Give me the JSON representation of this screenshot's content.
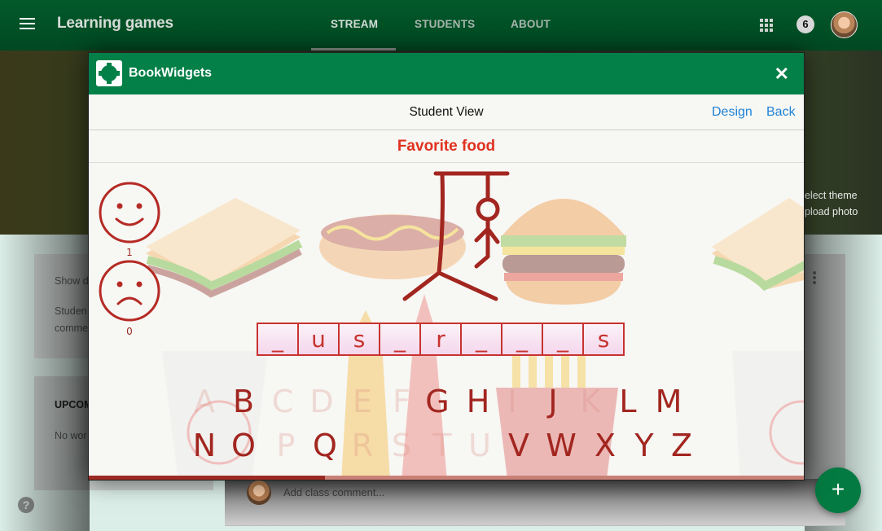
{
  "topbar": {
    "title": "Learning games",
    "tabs": [
      {
        "label": "STREAM",
        "active": true
      },
      {
        "label": "STUDENTS",
        "active": false
      },
      {
        "label": "ABOUT",
        "active": false
      }
    ],
    "notification_count": "6",
    "icons": {
      "menu": "hamburger-icon",
      "apps": "apps-grid-icon",
      "avatar": "user-avatar"
    }
  },
  "banner": {
    "select_theme": "elect theme",
    "upload_photo": "pload photo"
  },
  "background": {
    "left_card": {
      "line1": "Show d",
      "line2": "Studen",
      "line3": "comme"
    },
    "upcoming": {
      "heading": "UPCOM",
      "text": "No wor"
    },
    "comment_placeholder": "Add class comment...",
    "fab_label": "+",
    "help_label": "?"
  },
  "modal": {
    "brand": "BookWidgets",
    "close_label": "✕",
    "subbar": {
      "title": "Student View",
      "design_link": "Design",
      "back_link": "Back"
    },
    "game": {
      "title": "Favorite food",
      "correct_count": "1",
      "wrong_count": "0",
      "slots": [
        "_",
        "u",
        "s",
        "_",
        "r",
        "_",
        "_",
        "_",
        "s"
      ],
      "keyboard_rows": [
        [
          "A",
          "B",
          "C",
          "D",
          "E",
          "F",
          "G",
          "H",
          "I",
          "J",
          "K",
          "L",
          "M"
        ],
        [
          "N",
          "O",
          "P",
          "Q",
          "R",
          "S",
          "T",
          "U",
          "V",
          "W",
          "X",
          "Y",
          "Z"
        ]
      ],
      "used_letters": [
        "A",
        "C",
        "D",
        "E",
        "F",
        "I",
        "K",
        "P",
        "R",
        "S",
        "T",
        "U"
      ],
      "progress_percent": 33,
      "colors": {
        "accent": "#9b2a22",
        "title": "#e0321f",
        "header": "#037f48",
        "link": "#1f82d6"
      }
    }
  }
}
